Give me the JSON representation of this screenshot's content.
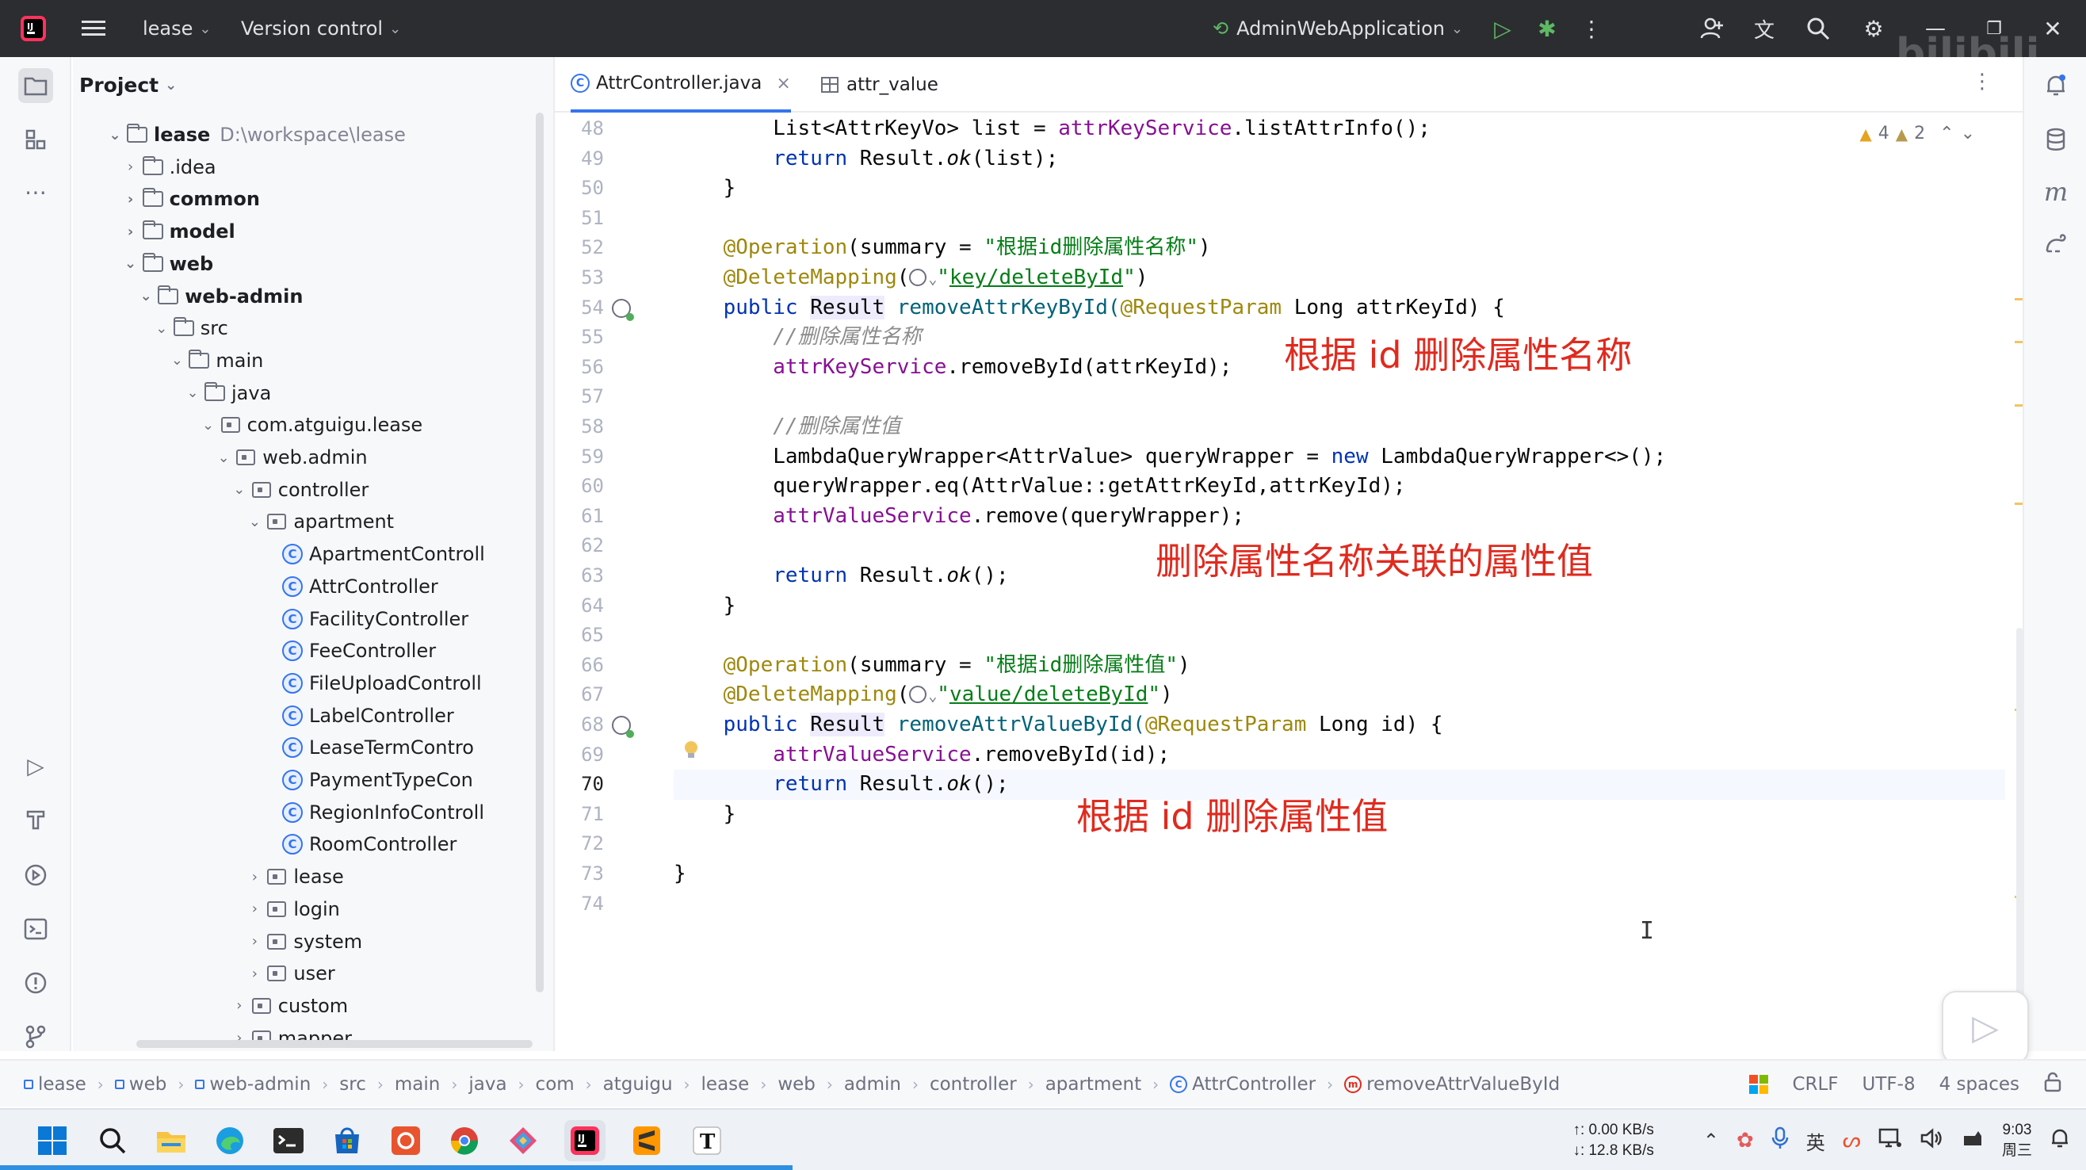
{
  "colors": {
    "accent": "#3574f0",
    "annotation_red": "#e02a1e",
    "titlebar_bg": "#2b2d30",
    "keyword": "#0033b3",
    "string": "#067d17",
    "annotation": "#9e880d",
    "field": "#871094"
  },
  "titlebar": {
    "project_name": "lease",
    "vcs_label": "Version control",
    "run_config": "AdminWebApplication",
    "watermark": "bilibili"
  },
  "project_panel": {
    "title": "Project",
    "tree": [
      {
        "label": "lease",
        "path": "D:\\workspace\\lease"
      },
      {
        "label": ".idea"
      },
      {
        "label": "common"
      },
      {
        "label": "model"
      },
      {
        "label": "web"
      },
      {
        "label": "web-admin"
      },
      {
        "label": "src"
      },
      {
        "label": "main"
      },
      {
        "label": "java"
      },
      {
        "label": "com.atguigu.lease"
      },
      {
        "label": "web.admin"
      },
      {
        "label": "controller"
      },
      {
        "label": "apartment"
      },
      {
        "label": "ApartmentControll"
      },
      {
        "label": "AttrController"
      },
      {
        "label": "FacilityController"
      },
      {
        "label": "FeeController"
      },
      {
        "label": "FileUploadControll"
      },
      {
        "label": "LabelController"
      },
      {
        "label": "LeaseTermContro"
      },
      {
        "label": "PaymentTypeCon"
      },
      {
        "label": "RegionInfoControll"
      },
      {
        "label": "RoomController"
      },
      {
        "label": "lease"
      },
      {
        "label": "login"
      },
      {
        "label": "system"
      },
      {
        "label": "user"
      },
      {
        "label": "custom"
      },
      {
        "label": "mapper"
      }
    ]
  },
  "tabs": [
    {
      "label": "AttrController.java",
      "close": "×"
    },
    {
      "label": "attr_value"
    }
  ],
  "inspections": {
    "warnings": "4",
    "weak_warnings": "2"
  },
  "editor": {
    "line_numbers": [
      "48",
      "49",
      "50",
      "51",
      "52",
      "53",
      "54",
      "55",
      "56",
      "57",
      "58",
      "59",
      "60",
      "61",
      "62",
      "63",
      "64",
      "65",
      "66",
      "67",
      "68",
      "69",
      "70",
      "71",
      "72",
      "73",
      "74"
    ],
    "current_line": "70",
    "code": {
      "l48": [
        "List<AttrKeyVo> list = ",
        "attrKeyService",
        ".listAttrInfo();"
      ],
      "l49": [
        "return",
        " Result.",
        "ok",
        "(list);"
      ],
      "l50": "}",
      "l52": [
        "@Operation",
        "(summary = ",
        "\"根据id删除属性名称\"",
        ")"
      ],
      "l53": [
        "@DeleteMapping",
        "(",
        "\"",
        "key/deleteById",
        "\"",
        ")"
      ],
      "l54": [
        "public",
        " ",
        "Result",
        " removeAttrKeyById(",
        "@RequestParam",
        " Long attrKeyId) {"
      ],
      "l55": "//删除属性名称",
      "l56": [
        "attrKeyService",
        ".removeById(attrKeyId);"
      ],
      "l58": "//删除属性值",
      "l59": [
        "LambdaQueryWrapper<AttrValue> queryWrapper = ",
        "new",
        " LambdaQueryWrapper<>();"
      ],
      "l60": "queryWrapper.eq(AttrValue::getAttrKeyId,attrKeyId);",
      "l61": [
        "attrValueService",
        ".remove(queryWrapper);"
      ],
      "l63": [
        "return",
        " Result.",
        "ok",
        "();"
      ],
      "l64": "}",
      "l66": [
        "@Operation",
        "(summary = ",
        "\"根据id删除属性值\"",
        ")"
      ],
      "l67": [
        "@DeleteMapping",
        "(",
        "\"",
        "value/deleteById",
        "\"",
        ")"
      ],
      "l68": [
        "public",
        " ",
        "Result",
        " removeAttrValueById(",
        "@RequestParam",
        " Long id) {"
      ],
      "l69": [
        "attrValueService",
        ".removeById(id);"
      ],
      "l70": [
        "return",
        " Result.",
        "ok",
        "();"
      ],
      "l71": "}",
      "l73": "}"
    },
    "annotations": [
      "根据 id 删除属性名称",
      "删除属性名称关联的属性值",
      "根据 id 删除属性值"
    ]
  },
  "statusbar": {
    "breadcrumbs": [
      "lease",
      "web",
      "web-admin",
      "src",
      "main",
      "java",
      "com",
      "atguigu",
      "lease",
      "web",
      "admin",
      "controller",
      "apartment",
      "AttrController",
      "removeAttrValueById"
    ],
    "line_separator": "CRLF",
    "encoding": "UTF-8",
    "indent": "4 spaces"
  },
  "taskbar": {
    "upload_speed": "↑: 0.00 KB/s",
    "download_speed": "↓: 12.8 KB/s",
    "time": "9:03",
    "day": "周三",
    "progress_fraction": 0.38
  }
}
